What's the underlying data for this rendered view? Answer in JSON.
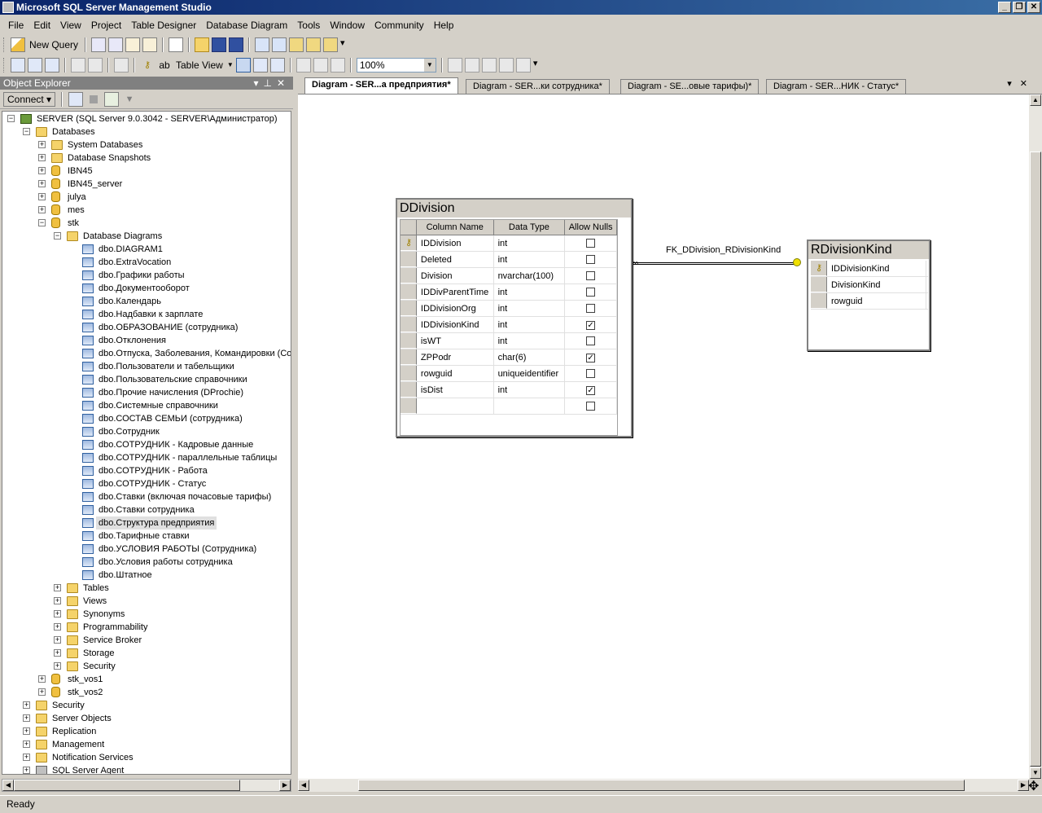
{
  "window": {
    "title": "Microsoft SQL Server Management Studio"
  },
  "menu": [
    "File",
    "Edit",
    "View",
    "Project",
    "Table Designer",
    "Database Diagram",
    "Tools",
    "Window",
    "Community",
    "Help"
  ],
  "toolbar": {
    "new_query": "New Query",
    "table_view": "Table View",
    "zoom": "100%"
  },
  "object_explorer": {
    "title": "Object Explorer",
    "connect": "Connect",
    "server": "SERVER (SQL Server 9.0.3042 - SERVER\\Администратор)",
    "databases": "Databases",
    "system_databases": "System Databases",
    "snapshots": "Database Snapshots",
    "db_ibn45": "IBN45",
    "db_ibn45_server": "IBN45_server",
    "db_julya": "julya",
    "db_mes": "mes",
    "db_stk": "stk",
    "database_diagrams": "Database Diagrams",
    "diagrams": [
      "dbo.DIAGRAM1",
      "dbo.ExtraVocation",
      "dbo.Графики работы",
      "dbo.Документооборот",
      "dbo.Календарь",
      "dbo.Надбавки к зарплате",
      "dbo.ОБРАЗОВАНИЕ (сотрудника)",
      "dbo.Отклонения",
      "dbo.Отпуска, Заболевания, Командировки (Со",
      "dbo.Пользователи и табельщики",
      "dbo.Пользовательские справочники",
      "dbo.Прочие начисления (DProchie)",
      "dbo.Системные справочники",
      "dbo.СОСТАВ СЕМЬИ (сотрудника)",
      "dbo.Сотрудник",
      "dbo.СОТРУДНИК - Кадровые данные",
      "dbo.СОТРУДНИК - параллельные таблицы",
      "dbo.СОТРУДНИК - Работа",
      "dbo.СОТРУДНИК - Статус",
      "dbo.Ставки (включая почасовые тарифы)",
      "dbo.Ставки сотрудника",
      "dbo.Структура предприятия",
      "dbo.Тарифные ставки",
      "dbo.УСЛОВИЯ РАБОТЫ (Сотрудника)",
      "dbo.Условия работы сотрудника",
      "dbo.Штатное"
    ],
    "stk_children": [
      "Tables",
      "Views",
      "Synonyms",
      "Programmability",
      "Service Broker",
      "Storage",
      "Security"
    ],
    "db_stk_vos1": "stk_vos1",
    "db_stk_vos2": "stk_vos2",
    "server_children": [
      "Security",
      "Server Objects",
      "Replication",
      "Management",
      "Notification Services"
    ],
    "agent": "SQL Server Agent"
  },
  "tabs": [
    {
      "label": "Diagram - SER...а предприятия*"
    },
    {
      "label": "Diagram - SER...ки сотрудника*"
    },
    {
      "label": "Diagram - SE...овые тарифы)*"
    },
    {
      "label": "Diagram - SER...НИК - Статус*"
    }
  ],
  "diagram": {
    "headers": {
      "col": "Column Name",
      "type": "Data Type",
      "nulls": "Allow Nulls"
    },
    "ddivision": {
      "title": "DDivision",
      "rows": [
        {
          "name": "IDDivision",
          "type": "int",
          "nulls": false,
          "pk": true
        },
        {
          "name": "Deleted",
          "type": "int",
          "nulls": false
        },
        {
          "name": "Division",
          "type": "nvarchar(100)",
          "nulls": false
        },
        {
          "name": "IDDivParentTime",
          "type": "int",
          "nulls": false
        },
        {
          "name": "IDDivisionOrg",
          "type": "int",
          "nulls": false
        },
        {
          "name": "IDDivisionKind",
          "type": "int",
          "nulls": true
        },
        {
          "name": "isWT",
          "type": "int",
          "nulls": false
        },
        {
          "name": "ZPPodr",
          "type": "char(6)",
          "nulls": true
        },
        {
          "name": "rowguid",
          "type": "uniqueidentifier",
          "nulls": false
        },
        {
          "name": "isDist",
          "type": "int",
          "nulls": true
        },
        {
          "name": "",
          "type": "",
          "nulls": false
        }
      ]
    },
    "rdivisionkind": {
      "title": "RDivisionKind",
      "rows": [
        {
          "name": "IDDivisionKind",
          "pk": true
        },
        {
          "name": "DivisionKind"
        },
        {
          "name": "rowguid"
        }
      ]
    },
    "relationship": "FK_DDivision_RDivisionKind"
  },
  "status": "Ready"
}
